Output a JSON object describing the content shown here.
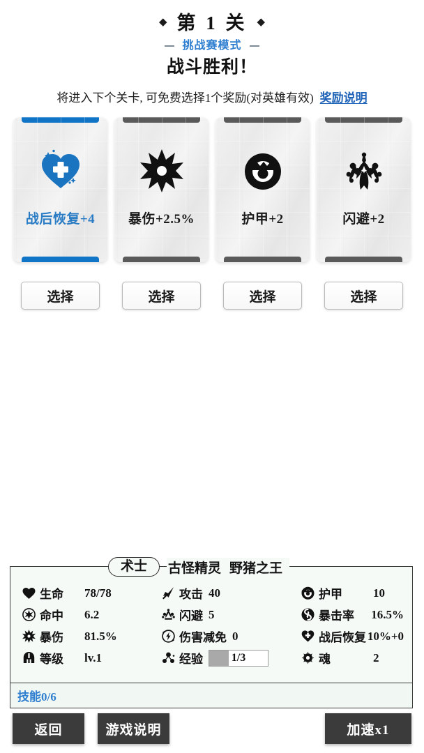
{
  "header": {
    "left_diamond": "◆",
    "right_diamond": "◆",
    "stage_title": "第 1 关",
    "mode_label": "挑战赛模式",
    "result_title": "战斗胜利！",
    "description": "将进入下个关卡, 可免费选择1个奖励(对英雄有效)",
    "reward_help_link": "奖励说明"
  },
  "rewards": {
    "select_label": "选择",
    "cards": [
      {
        "label": "战后恢复+4",
        "icon": "heart-plus-icon",
        "selected": true
      },
      {
        "label": "暴伤+2.5%",
        "icon": "starburst-icon",
        "selected": false
      },
      {
        "label": "护甲+2",
        "icon": "armor-ring-icon",
        "selected": false
      },
      {
        "label": "闪避+2",
        "icon": "plume-crown-icon",
        "selected": false
      }
    ]
  },
  "character": {
    "class_name": "术士",
    "title_name": "古怪精灵",
    "boss_name": "野猪之王",
    "stats": [
      {
        "icon": "heart-icon",
        "name": "生命",
        "value": "78/78"
      },
      {
        "icon": "sword-icon",
        "name": "攻击",
        "value": "40"
      },
      {
        "icon": "armor-ring-icon",
        "name": "护甲",
        "value": "10"
      },
      {
        "icon": "target-star-icon",
        "name": "命中",
        "value": "6.2"
      },
      {
        "icon": "dodge-icon",
        "name": "闪避",
        "value": "5"
      },
      {
        "icon": "crit-swirl-icon",
        "name": "暴击率",
        "value": "16.5%"
      },
      {
        "icon": "starburst-icon",
        "name": "暴伤",
        "value": "81.5%"
      },
      {
        "icon": "shield-bolt-icon",
        "name": "伤害减免",
        "value": "0"
      },
      {
        "icon": "heart-plus-icon",
        "name": "战后恢复",
        "value": "10%+0"
      },
      {
        "icon": "helmet-icon",
        "name": "等级",
        "value": "lv.1"
      },
      {
        "icon": "exp-orbs-icon",
        "name": "经验",
        "value": "1/3",
        "is_bar": true,
        "fill_percent": 33
      },
      {
        "icon": "soul-icon",
        "name": "魂",
        "value": "2"
      }
    ]
  },
  "skills": {
    "label": "技能0/6"
  },
  "bottom": {
    "back": "返回",
    "guide": "游戏说明",
    "speed": "加速x1"
  },
  "colors": {
    "accent_blue": "#2f7fd0",
    "link_blue": "#1f63b8",
    "selected_bar": "#1175c7",
    "card_bar": "#5a5a5a",
    "dark_button": "#3b3b3b",
    "panel_bg": "#f6faf7"
  }
}
